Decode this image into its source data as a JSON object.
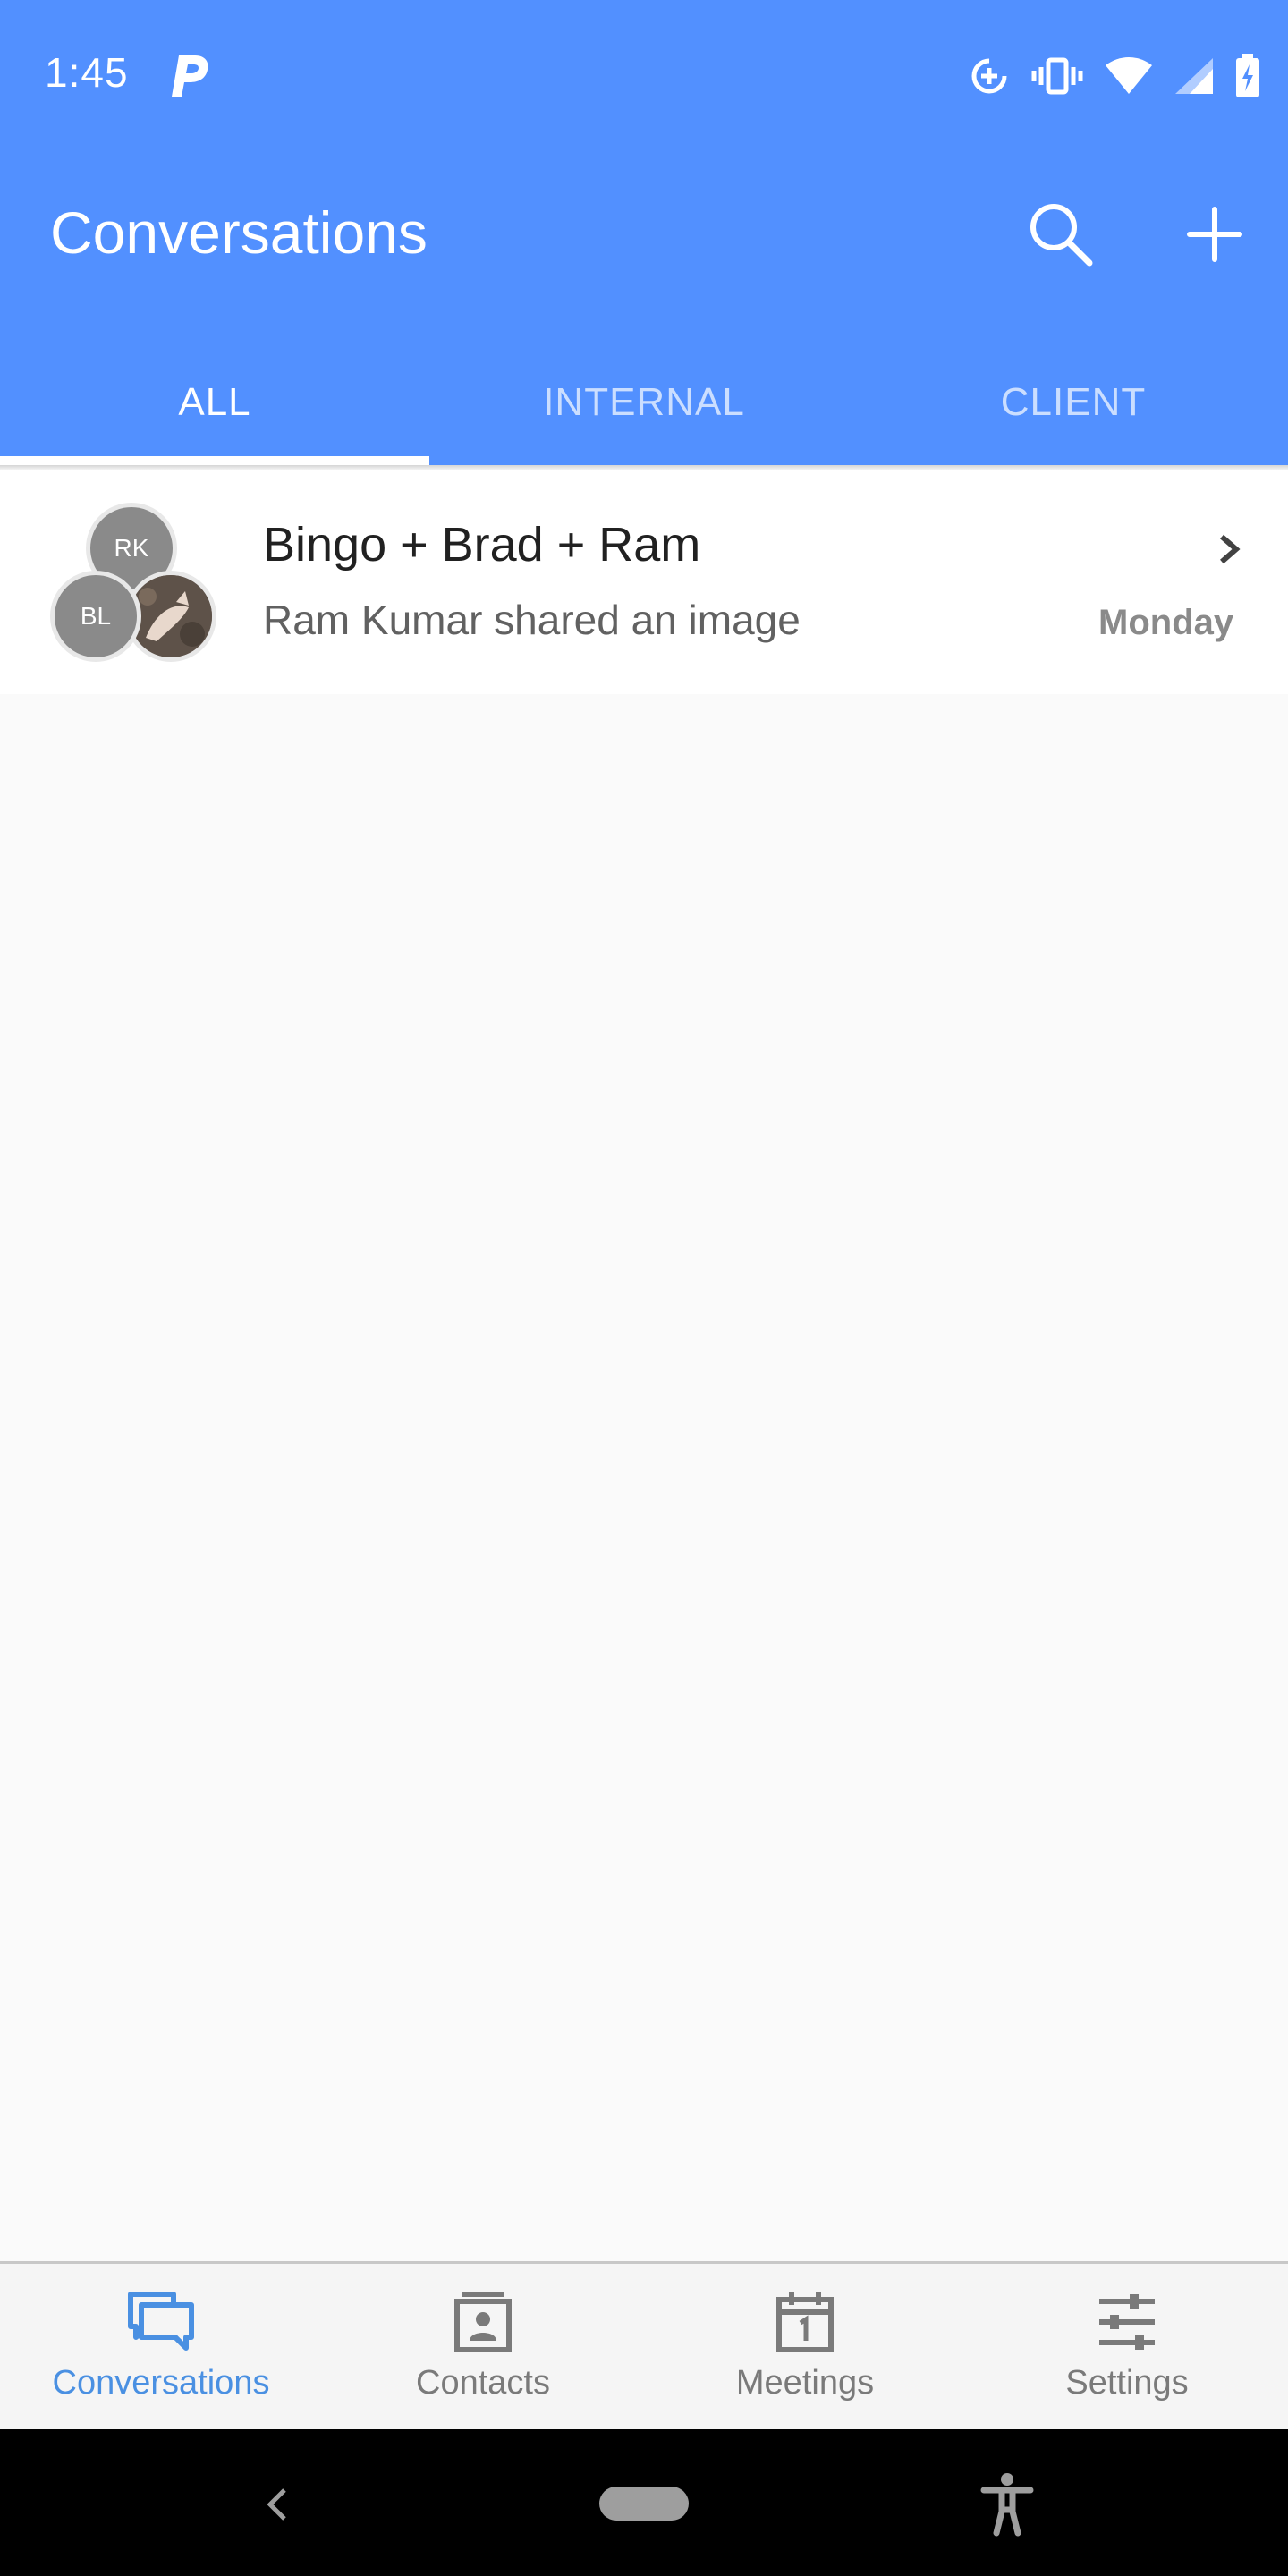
{
  "status_bar": {
    "time": "1:45"
  },
  "app_bar": {
    "title": "Conversations"
  },
  "tabs": [
    {
      "label": "ALL",
      "active": true
    },
    {
      "label": "INTERNAL",
      "active": false
    },
    {
      "label": "CLIENT",
      "active": false
    }
  ],
  "conversations": [
    {
      "title": "Bingo + Brad + Ram",
      "preview": "Ram Kumar shared an image",
      "time": "Monday",
      "avatars": [
        "RK",
        "BL"
      ]
    }
  ],
  "bottom_nav": [
    {
      "label": "Conversations",
      "icon": "conversations-icon",
      "active": true
    },
    {
      "label": "Contacts",
      "icon": "contacts-icon",
      "active": false
    },
    {
      "label": "Meetings",
      "icon": "meetings-icon",
      "active": false
    },
    {
      "label": "Settings",
      "icon": "settings-icon",
      "active": false
    }
  ],
  "colors": {
    "primary": "#5290ff",
    "active_nav": "#4a90e2"
  }
}
